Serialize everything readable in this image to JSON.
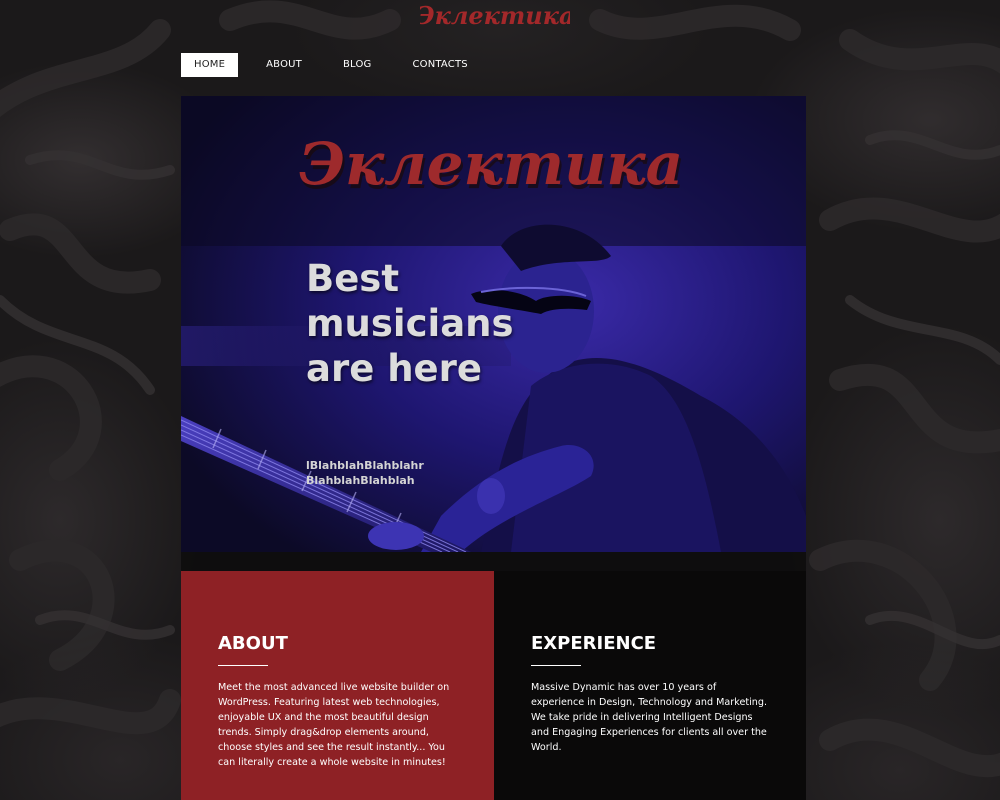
{
  "brand": {
    "logo_text": "Эклектика",
    "accent_color": "#8e2125",
    "logo_color": "#a3282a"
  },
  "nav": {
    "items": [
      {
        "label": "HOME",
        "active": true
      },
      {
        "label": "ABOUT",
        "active": false
      },
      {
        "label": "BLOG",
        "active": false
      },
      {
        "label": "CONTACTS",
        "active": false
      }
    ]
  },
  "hero": {
    "heading": "Best musicians are here",
    "subheading": "lBlahblahBlahblahr BlahblahBlahblah",
    "image": "guitarist-in-blue-light"
  },
  "sections": {
    "about": {
      "title": "ABOUT",
      "text": "Meet the most advanced live website builder on WordPress. Featuring latest web technologies, enjoyable UX and the most beautiful design trends. Simply drag&drop elements around, choose styles and see the result instantly... You can literally create a whole website in minutes!"
    },
    "experience": {
      "title": "EXPERIENCE",
      "text": "Massive Dynamic has over 10 years of experience in Design, Technology and Marketing. We take pride in delivering Intelligent Designs and Engaging Experiences for clients all over the World."
    }
  }
}
